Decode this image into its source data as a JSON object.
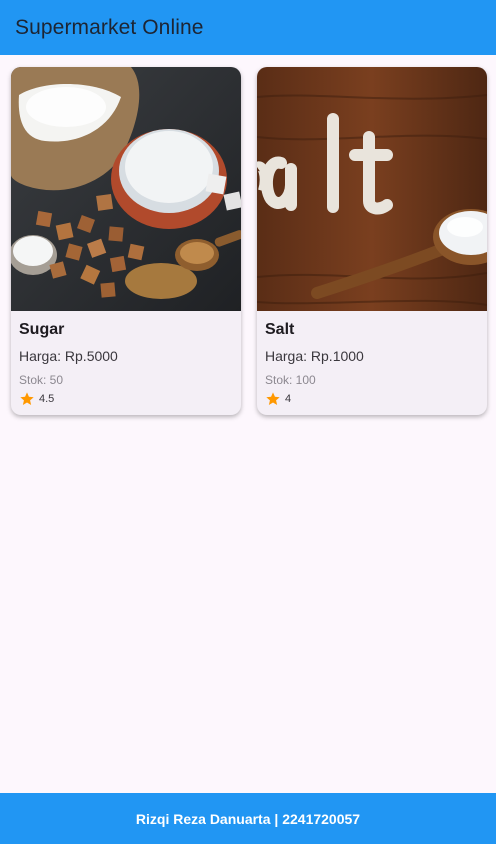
{
  "app_bar": {
    "title": "Supermarket Online"
  },
  "products": [
    {
      "name": "Sugar",
      "price": "Harga: Rp.5000",
      "stock": "Stok: 50",
      "rating": "4.5",
      "image_icon": "sugar-photo"
    },
    {
      "name": "Salt",
      "price": "Harga: Rp.1000",
      "stock": "Stok: 100",
      "rating": "4",
      "image_icon": "salt-photo"
    }
  ],
  "footer": {
    "text": "Rizqi Reza Danuarta | 2241720057"
  },
  "colors": {
    "primary": "#2196f3",
    "background": "#fdf7fd",
    "card": "#f4eff6",
    "star": "#ff9800",
    "footer_text": "#ffffff"
  }
}
